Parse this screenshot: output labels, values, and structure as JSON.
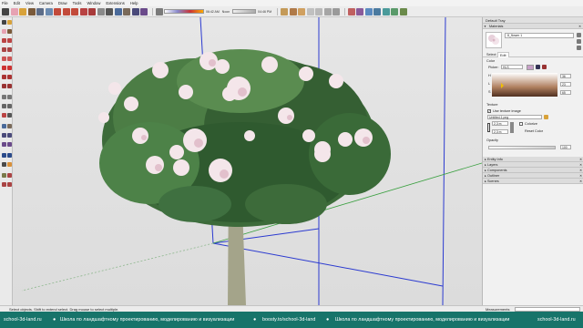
{
  "menu": [
    "File",
    "Edit",
    "View",
    "Camera",
    "Draw",
    "Tools",
    "Window",
    "Extensions",
    "Help"
  ],
  "toolbar": {
    "time_am": "06:42 AM",
    "noon": "Noon",
    "time_pm": "04:46 PM"
  },
  "tray": {
    "title": "Default Tray",
    "materials_header": "Materials",
    "material_name": "8_flower 1",
    "tab_select": "Select",
    "tab_edit": "Edit",
    "color_label": "Color",
    "picker_label": "Picker:",
    "picker_value": "HLS",
    "h_label": "H",
    "h_value": "36",
    "l_label": "L",
    "l_value": "23",
    "s_label": "S",
    "s_value": "65",
    "texture_label": "Texture",
    "use_texture_label": "Use texture image",
    "texture_file": "Untitled-1.png",
    "width_value": "2,3 m",
    "height_value": "2,3 m",
    "colorize_label": "Colorize",
    "reset_color_label": "Reset Color",
    "opacity_label": "Opacity",
    "opacity_value": "100",
    "collapsed_sections": [
      "Entity Info",
      "Layers",
      "Components",
      "Outliner",
      "Scenes"
    ]
  },
  "status": {
    "hint": "Select objects. Shift to extend select. Drag mouse to select multiple.",
    "measurements_label": "Measurements"
  },
  "ticker": {
    "site_a": "school-3d-land.ru",
    "slogan_a": "Школа по ландшафтному проектированию, моделированию и визуализации",
    "boosty": "boosty.to/school-3d-land",
    "slogan_b": "Школа по ландшафтному проектированию, моделированию и визуализации",
    "site_b": "school-3d-land.ru"
  },
  "colors": {
    "ticker_bg": "#17746a",
    "swatch": "#c8a0c8",
    "foliage": "#3a6a38",
    "flower": "#f4e6ea",
    "axis_blue": "#2b3ad0",
    "axis_green": "#3aa040",
    "trunk": "#a4a48a"
  }
}
